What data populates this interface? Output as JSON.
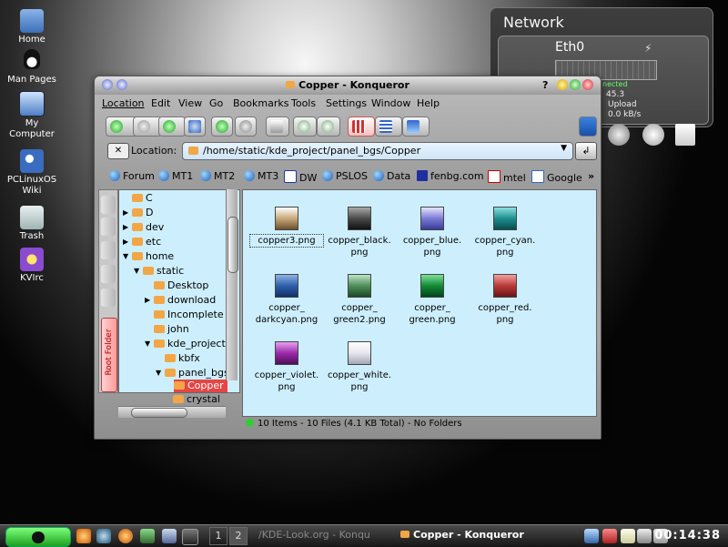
{
  "desktop": {
    "icons": [
      {
        "label": "Home"
      },
      {
        "label": "Man Pages"
      },
      {
        "label": "My Computer"
      },
      {
        "label": "PCLinuxOS Wiki"
      },
      {
        "label": "Trash"
      },
      {
        "label": "KVIrc"
      }
    ]
  },
  "network": {
    "title": "Network",
    "interface": "Eth0",
    "status": "nected",
    "ip": "45.3",
    "upload_label": "Upload",
    "upload_rate": "0.0 kB/s"
  },
  "window": {
    "title": "Copper - Konqueror",
    "help_glyph": "?",
    "menu": [
      "Location",
      "Edit",
      "View",
      "Go",
      "Bookmarks",
      "Tools",
      "Settings",
      "Window",
      "Help"
    ],
    "location_label": "Location:",
    "location_value": "/home/static/kde_project/panel_bgs/Copper",
    "bookmarks": [
      "Forum",
      "MT1",
      "MT2",
      "MT3",
      "DW",
      "PSLOS",
      "Data",
      "fenbg.com",
      "mtel",
      "Google"
    ],
    "bookmarks_more": "»",
    "sidebar_tab": "Root Folder",
    "tree": [
      {
        "label": "C",
        "depth": 0,
        "arrow": ""
      },
      {
        "label": "D",
        "depth": 0,
        "arrow": "▶"
      },
      {
        "label": "dev",
        "depth": 0,
        "arrow": "▶"
      },
      {
        "label": "etc",
        "depth": 0,
        "arrow": "▶"
      },
      {
        "label": "home",
        "depth": 0,
        "arrow": "▼"
      },
      {
        "label": "static",
        "depth": 1,
        "arrow": "▼"
      },
      {
        "label": "Desktop",
        "depth": 2,
        "arrow": ""
      },
      {
        "label": "download",
        "depth": 2,
        "arrow": "▶"
      },
      {
        "label": "Incomplete",
        "depth": 2,
        "arrow": ""
      },
      {
        "label": "john",
        "depth": 2,
        "arrow": ""
      },
      {
        "label": "kde_project",
        "depth": 2,
        "arrow": "▼"
      },
      {
        "label": "kbfx",
        "depth": 3,
        "arrow": ""
      },
      {
        "label": "panel_bgs",
        "depth": 3,
        "arrow": "▼"
      },
      {
        "label": "Copper",
        "depth": 4,
        "arrow": ""
      },
      {
        "label": "crystal",
        "depth": 4,
        "arrow": ""
      }
    ],
    "files": [
      {
        "name": "copper3.png",
        "color": "#c8a97a"
      },
      {
        "name": "copper_black.\npng",
        "color": "#4a4a4a"
      },
      {
        "name": "copper_blue.\npng",
        "color": "#7b7bd6"
      },
      {
        "name": "copper_cyan.\npng",
        "color": "#1f8e8e"
      },
      {
        "name": "copper_\ndarkcyan.png",
        "color": "#2e5fa8"
      },
      {
        "name": "copper_\ngreen2.png",
        "color": "#4e8e5a"
      },
      {
        "name": "copper_\ngreen.png",
        "color": "#138a36"
      },
      {
        "name": "copper_red.\npng",
        "color": "#b83a3a"
      },
      {
        "name": "copper_violet.\npng",
        "color": "#9b2aa8"
      },
      {
        "name": "copper_white.\npng",
        "color": "#e6e6ee"
      }
    ],
    "status": "10 Items - 10 Files (4.1 KB Total) - No Folders"
  },
  "panel": {
    "desktops": [
      "1",
      "2"
    ],
    "tasks": [
      {
        "label": "/KDE-Look.org - Konqu",
        "active": false
      },
      {
        "label": "Copper - Konqueror",
        "active": true
      }
    ],
    "clock": "00:14:38"
  }
}
